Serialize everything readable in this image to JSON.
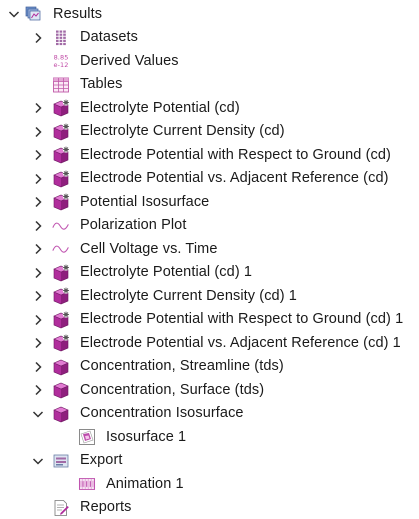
{
  "colors": {
    "plot_group": "#b02d9c",
    "plot_group_light": "#e27bd3",
    "chevron": "#333333",
    "wave": "#c055b0"
  },
  "tree": [
    {
      "label": "Results",
      "level": 0,
      "toggle": "expanded",
      "icon": "results-folder-icon"
    },
    {
      "label": "Datasets",
      "level": 1,
      "toggle": "collapsed",
      "icon": "datasets-icon"
    },
    {
      "label": "Derived Values",
      "level": 1,
      "toggle": "none",
      "icon": "derived-values-icon",
      "icon_text_top": "8.85",
      "icon_text_bottom": "e-12"
    },
    {
      "label": "Tables",
      "level": 1,
      "toggle": "none",
      "icon": "tables-icon"
    },
    {
      "label": "Electrolyte Potential (cd)",
      "level": 1,
      "toggle": "collapsed",
      "icon": "plot-group-3d-icon"
    },
    {
      "label": "Electrolyte Current Density (cd)",
      "level": 1,
      "toggle": "collapsed",
      "icon": "plot-group-3d-icon"
    },
    {
      "label": "Electrode Potential with Respect to Ground (cd)",
      "level": 1,
      "toggle": "collapsed",
      "icon": "plot-group-3d-icon"
    },
    {
      "label": "Electrode Potential vs. Adjacent Reference (cd)",
      "level": 1,
      "toggle": "collapsed",
      "icon": "plot-group-3d-icon"
    },
    {
      "label": "Potential Isosurface",
      "level": 1,
      "toggle": "collapsed",
      "icon": "plot-group-3d-icon"
    },
    {
      "label": "Polarization Plot",
      "level": 1,
      "toggle": "collapsed",
      "icon": "plot-1d-wave-icon"
    },
    {
      "label": "Cell Voltage vs. Time",
      "level": 1,
      "toggle": "collapsed",
      "icon": "plot-1d-wave-icon"
    },
    {
      "label": "Electrolyte Potential (cd) 1",
      "level": 1,
      "toggle": "collapsed",
      "icon": "plot-group-3d-icon"
    },
    {
      "label": "Electrolyte Current Density (cd) 1",
      "level": 1,
      "toggle": "collapsed",
      "icon": "plot-group-3d-icon"
    },
    {
      "label": "Electrode Potential with Respect to Ground (cd) 1",
      "level": 1,
      "toggle": "collapsed",
      "icon": "plot-group-3d-icon"
    },
    {
      "label": "Electrode Potential vs. Adjacent Reference (cd) 1",
      "level": 1,
      "toggle": "collapsed",
      "icon": "plot-group-3d-icon"
    },
    {
      "label": "Concentration, Streamline (tds)",
      "level": 1,
      "toggle": "collapsed",
      "icon": "plot-group-3d-plain-icon"
    },
    {
      "label": "Concentration, Surface (tds)",
      "level": 1,
      "toggle": "collapsed",
      "icon": "plot-group-3d-plain-icon"
    },
    {
      "label": "Concentration Isosurface",
      "level": 1,
      "toggle": "expanded",
      "icon": "plot-group-3d-plain-icon"
    },
    {
      "label": "Isosurface 1",
      "level": 2,
      "toggle": "none",
      "icon": "isosurface-icon"
    },
    {
      "label": "Export",
      "level": 1,
      "toggle": "expanded",
      "icon": "export-icon"
    },
    {
      "label": "Animation 1",
      "level": 2,
      "toggle": "none",
      "icon": "animation-icon"
    },
    {
      "label": "Reports",
      "level": 1,
      "toggle": "none",
      "icon": "reports-icon"
    }
  ]
}
